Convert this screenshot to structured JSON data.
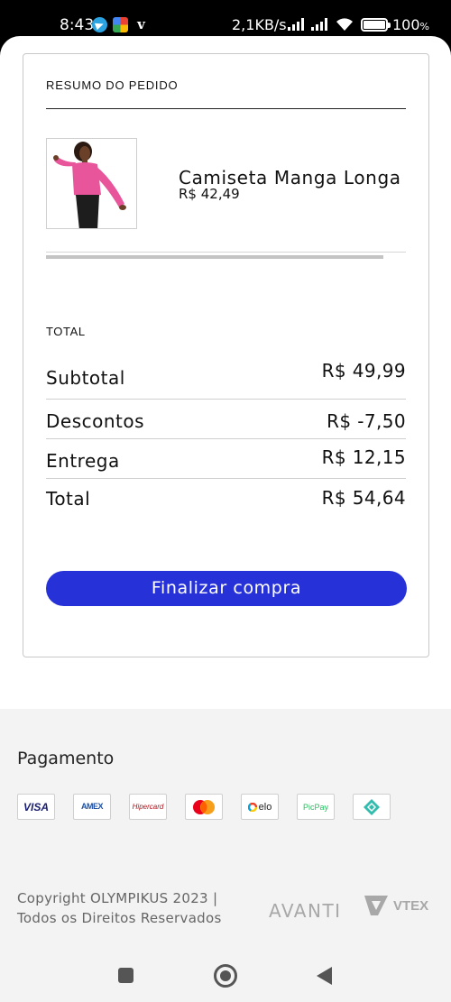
{
  "status_bar": {
    "time": "8:43",
    "network_speed": "2,1KB/s",
    "battery": "100"
  },
  "order_summary": {
    "heading": "RESUMO DO PEDIDO",
    "product": {
      "name": "Camiseta Manga Longa",
      "price": "R$ 42,49",
      "image_icon": "product-photo-icon"
    }
  },
  "totals": {
    "heading": "TOTAL",
    "rows": [
      {
        "label": "Subtotal",
        "value": "R$ 49,99"
      },
      {
        "label": "Descontos",
        "value": "R$ -7,50"
      },
      {
        "label": "Entrega",
        "value": "R$ 12,15"
      },
      {
        "label": "Total",
        "value": "R$ 54,64"
      }
    ]
  },
  "checkout_button": {
    "label": "Finalizar compra",
    "color": "#2632d8"
  },
  "payment": {
    "heading": "Pagamento",
    "methods": [
      "VISA",
      "AMEX",
      "Hipercard",
      "Mastercard",
      "elo",
      "PicPay",
      "Pix"
    ]
  },
  "footer": {
    "copyright_line1": "Copyright OLYMPIKUS 2023 |",
    "copyright_line2": "Todos os Direitos Reservados",
    "partner_avanti": "AVANTI",
    "partner_vtex": "VTEX"
  }
}
